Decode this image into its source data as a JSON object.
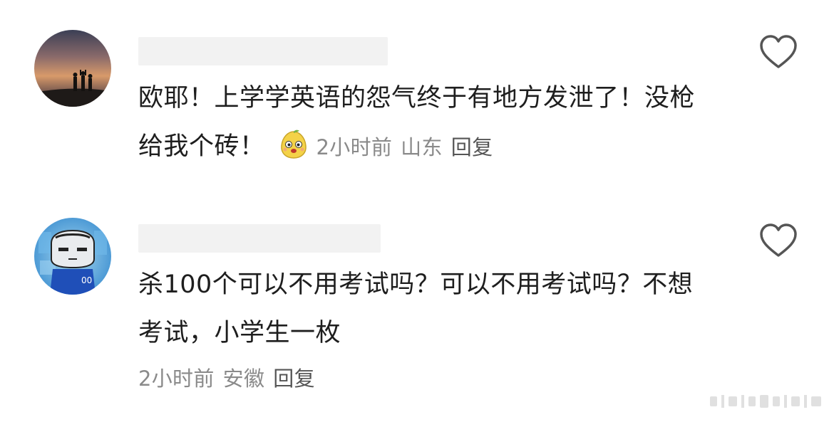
{
  "comments": [
    {
      "text": "欧耶！上学学英语的怨气终于有地方发泄了！没枪给我个砖！",
      "emoji": "pear-mascot-emoji",
      "time": "2小时前",
      "location": "山东",
      "reply_label": "回复",
      "like_icon": "heart-outline-icon"
    },
    {
      "text": "杀100个可以不用考试吗？可以不用考试吗？不想考试，小学生一枚",
      "time": "2小时前",
      "location": "安徽",
      "reply_label": "回复",
      "like_icon": "heart-outline-icon"
    }
  ],
  "colors": {
    "text": "#1e1e1e",
    "meta": "#8a8a8a",
    "reply": "#555555",
    "name_placeholder": "#f2f2f2"
  }
}
